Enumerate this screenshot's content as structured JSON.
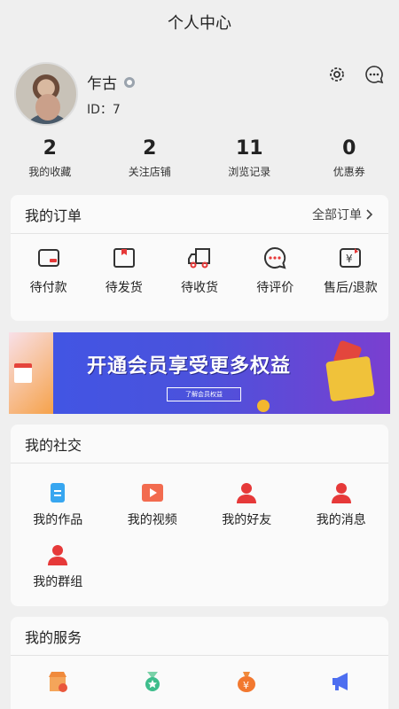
{
  "header": {
    "title": "个人中心"
  },
  "profile": {
    "name": "乍古",
    "id_text": "ID：7"
  },
  "stats": [
    {
      "value": "2",
      "label": "我的收藏"
    },
    {
      "value": "2",
      "label": "关注店铺"
    },
    {
      "value": "11",
      "label": "浏览记录"
    },
    {
      "value": "0",
      "label": "优惠券"
    }
  ],
  "orders": {
    "title": "我的订单",
    "more": "全部订单",
    "items": [
      {
        "label": "待付款",
        "icon": "wallet-icon"
      },
      {
        "label": "待发货",
        "icon": "box-icon"
      },
      {
        "label": "待收货",
        "icon": "truck-icon"
      },
      {
        "label": "待评价",
        "icon": "chat-icon"
      },
      {
        "label": "售后/退款",
        "icon": "refund-icon"
      }
    ]
  },
  "banner": {
    "headline": "开通会员享受更多权益",
    "cta": "了解会员权益"
  },
  "social": {
    "title": "我的社交",
    "items": [
      {
        "label": "我的作品",
        "icon": "document-icon"
      },
      {
        "label": "我的视频",
        "icon": "video-icon"
      },
      {
        "label": "我的好友",
        "icon": "user-icon"
      },
      {
        "label": "我的消息",
        "icon": "user-icon"
      },
      {
        "label": "我的群组",
        "icon": "user-icon"
      }
    ]
  },
  "services": {
    "title": "我的服务",
    "items": [
      {
        "label": "",
        "icon": "store-icon"
      },
      {
        "label": "",
        "icon": "medal-icon"
      },
      {
        "label": "",
        "icon": "money-bag-icon"
      },
      {
        "label": "",
        "icon": "megaphone-icon"
      }
    ]
  },
  "colors": {
    "accent": "#e63939",
    "banner": "#4a52dc",
    "background": "#efefef"
  }
}
